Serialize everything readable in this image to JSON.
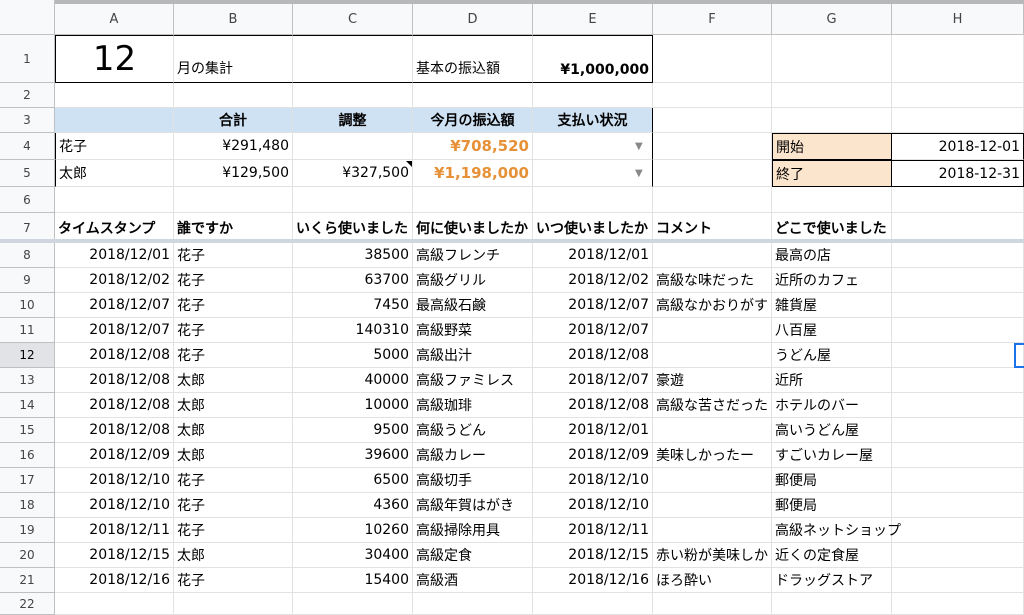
{
  "columns": [
    "A",
    "B",
    "C",
    "D",
    "E",
    "F",
    "G",
    "H"
  ],
  "rows": [
    "1",
    "2",
    "3",
    "4",
    "5",
    "6",
    "7",
    "8",
    "9",
    "10",
    "11",
    "12",
    "13",
    "14",
    "15",
    "16",
    "17",
    "18",
    "19",
    "20",
    "21",
    "22"
  ],
  "summary": {
    "month": "12",
    "month_label": "月の集計",
    "base_transfer_label": "基本の振込額",
    "base_transfer_value": "¥1,000,000",
    "headers": [
      "合計",
      "調整",
      "今月の振込額",
      "支払い状況"
    ],
    "people": [
      {
        "name": "花子",
        "total": "¥291,480",
        "adjust": "",
        "transfer": "¥708,520",
        "status": ""
      },
      {
        "name": "太郎",
        "total": "¥129,500",
        "adjust": "¥327,500",
        "transfer": "¥1,198,000",
        "status": ""
      }
    ],
    "start_label": "開始",
    "start_value": "2018-12-01",
    "end_label": "終了",
    "end_value": "2018-12-31"
  },
  "log_headers": [
    "タイムスタンプ",
    "誰ですか",
    "いくら使いました",
    "何に使いましたか",
    "いつ使いましたか",
    "コメント",
    "どこで使いました"
  ],
  "log_rows": [
    [
      "2018/12/01",
      "花子",
      "38500",
      "高級フレンチ",
      "2018/12/01",
      "",
      "最高の店"
    ],
    [
      "2018/12/02",
      "花子",
      "63700",
      "高級グリル",
      "2018/12/02",
      "高級な味だった",
      "近所のカフェ"
    ],
    [
      "2018/12/07",
      "花子",
      "7450",
      "最高級石鹸",
      "2018/12/07",
      "高級なかおりがす",
      "雑貨屋"
    ],
    [
      "2018/12/07",
      "花子",
      "140310",
      "高級野菜",
      "2018/12/07",
      "",
      "八百屋"
    ],
    [
      "2018/12/08",
      "花子",
      "5000",
      "高級出汁",
      "2018/12/08",
      "",
      "うどん屋"
    ],
    [
      "2018/12/08",
      "太郎",
      "40000",
      "高級ファミレス",
      "2018/12/07",
      "豪遊",
      "近所"
    ],
    [
      "2018/12/08",
      "太郎",
      "10000",
      "高級珈琲",
      "2018/12/08",
      "高級な苦さだった",
      "ホテルのバー"
    ],
    [
      "2018/12/08",
      "太郎",
      "9500",
      "高級うどん",
      "2018/12/01",
      "",
      "高いうどん屋"
    ],
    [
      "2018/12/09",
      "太郎",
      "39600",
      "高級カレー",
      "2018/12/09",
      "美味しかったー",
      "すごいカレー屋"
    ],
    [
      "2018/12/10",
      "花子",
      "6500",
      "高級切手",
      "2018/12/10",
      "",
      "郵便局"
    ],
    [
      "2018/12/10",
      "花子",
      "4360",
      "高級年賀はがき",
      "2018/12/10",
      "",
      "郵便局"
    ],
    [
      "2018/12/11",
      "花子",
      "10260",
      "高級掃除用具",
      "2018/12/11",
      "",
      "高級ネットショップ"
    ],
    [
      "2018/12/15",
      "太郎",
      "30400",
      "高級定食",
      "2018/12/15",
      "赤い粉が美味しか",
      "近くの定食屋"
    ],
    [
      "2018/12/16",
      "花子",
      "15400",
      "高級酒",
      "2018/12/16",
      "ほろ酔い",
      "ドラッグストア"
    ]
  ],
  "colors": {
    "header_blue": "#cfe2f3",
    "orange": "#e69138",
    "peach": "#fce5cd",
    "selection": "#1a73e8"
  },
  "icons": {
    "dropdown": "chevron-down-icon"
  }
}
